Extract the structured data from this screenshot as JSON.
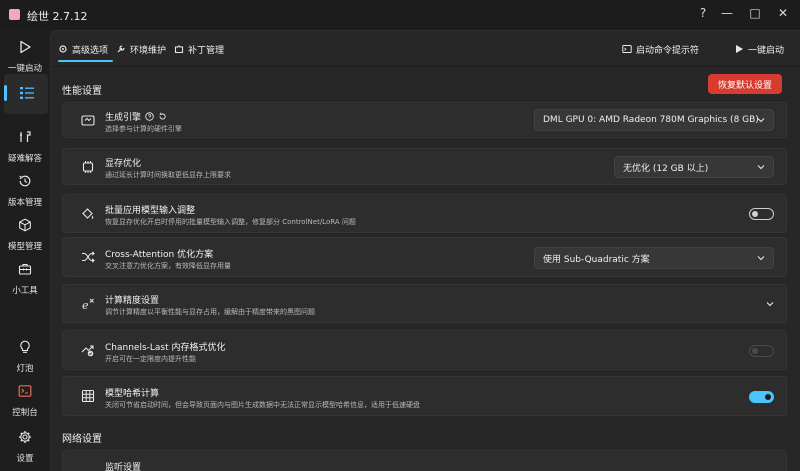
{
  "window": {
    "title": "绘世 2.7.12",
    "help": "?",
    "minimize": "—",
    "maximize": "□",
    "close": "✕"
  },
  "sidebar": {
    "items": [
      {
        "label": "一键启动",
        "icon": "play-icon"
      },
      {
        "label": "",
        "icon": "list-icon",
        "active": true
      },
      {
        "label": "疑难解答",
        "icon": "wrench-icon"
      },
      {
        "label": "版本管理",
        "icon": "history-icon"
      },
      {
        "label": "模型管理",
        "icon": "cube-icon"
      },
      {
        "label": "小工具",
        "icon": "toolbox-icon"
      },
      {
        "label": "灯泡",
        "icon": "lightbulb-icon"
      },
      {
        "label": "控制台",
        "icon": "console-icon"
      },
      {
        "label": "设置",
        "icon": "gear-icon"
      }
    ]
  },
  "tabs": {
    "advanced": "高级选项",
    "environment": "环境维护",
    "patches": "补丁管理",
    "launch_prompt": "启动命令提示符",
    "one_click": "一键启动"
  },
  "performance": {
    "section_title": "性能设置",
    "reset_label": "恢复默认设置",
    "engine": {
      "title": "生成引擎",
      "desc": "选择参与计算的硬件引擎",
      "value": "DML GPU 0: AMD Radeon 780M Graphics (8 GB)"
    },
    "vram": {
      "title": "显存优化",
      "desc": "通过延长计算时间换取更低显存上限要求",
      "value": "无优化 (12 GB 以上)"
    },
    "batch": {
      "title": "批量应用模型输入调整",
      "desc": "恢复显存优化开启时停用的批量模型输入调整，修复部分 ControlNet/LoRA 问题",
      "enabled": false
    },
    "cross_attention": {
      "title": "Cross-Attention 优化方案",
      "desc": "交叉注意力优化方案，有效降低显存用量",
      "value": "使用 Sub-Quadratic 方案"
    },
    "precision": {
      "title": "计算精度设置",
      "desc": "调节计算精度以平衡性能与显存占用，缓解由于精度带来的黑图问题"
    },
    "channels_last": {
      "title": "Channels-Last 内存格式优化",
      "desc": "开启可在一定限度内提升性能",
      "enabled": false,
      "disabled": true
    },
    "model_hash": {
      "title": "模型哈希计算",
      "desc": "关闭可节省启动时间，但会导致页面内与图片生成数据中无法正常显示模型哈希信息，适用于低速硬盘",
      "enabled": true
    }
  },
  "network": {
    "section_title": "网络设置",
    "first_item_title": "监听设置"
  },
  "colors": {
    "accent": "#4cc2ff",
    "danger": "#d83b2f",
    "background": "#272727",
    "card": "#2d2d2d"
  }
}
